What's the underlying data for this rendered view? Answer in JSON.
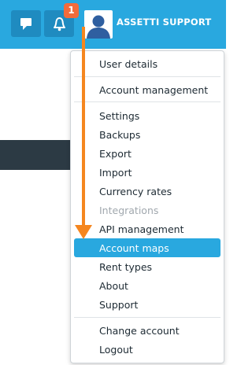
{
  "header": {
    "user_name": "ASSETTI SUPPORT",
    "notification_count": "1",
    "colors": {
      "bar": "#29a8df",
      "button": "#1f8bc0",
      "badge": "#f36b3b",
      "annotation_arrow": "#f5861f"
    },
    "icons": [
      "chat-icon",
      "bell-icon",
      "user-avatar-icon"
    ]
  },
  "menu": {
    "sections": [
      {
        "items": [
          {
            "label": "User details"
          }
        ]
      },
      {
        "items": [
          {
            "label": "Account management"
          }
        ]
      },
      {
        "items": [
          {
            "label": "Settings"
          },
          {
            "label": "Backups"
          },
          {
            "label": "Export"
          },
          {
            "label": "Import"
          },
          {
            "label": "Currency rates"
          },
          {
            "label": "Integrations",
            "disabled": true
          },
          {
            "label": "API management"
          },
          {
            "label": "Account maps",
            "active": true
          },
          {
            "label": "Rent types"
          },
          {
            "label": "About"
          },
          {
            "label": "Support"
          }
        ]
      },
      {
        "items": [
          {
            "label": "Change account"
          },
          {
            "label": "Logout"
          }
        ]
      }
    ]
  }
}
